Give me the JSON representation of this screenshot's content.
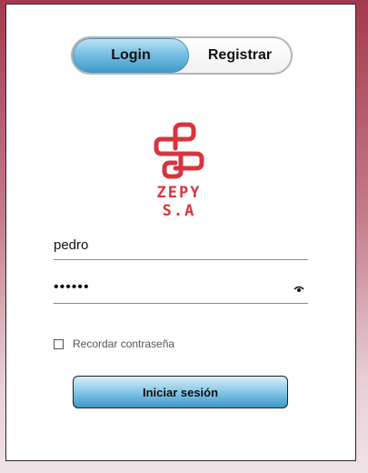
{
  "tabs": {
    "login_label": "Login",
    "register_label": "Registrar",
    "active": "Login"
  },
  "brand": {
    "name": "ZEPY S.A",
    "color": "#d8343f"
  },
  "form": {
    "username_value": "pedro",
    "password_masked": "••••••",
    "eye_icon": "eye-icon",
    "remember_label": "Recordar contraseña",
    "remember_checked": false,
    "submit_label": "Iniciar sesión"
  },
  "colors": {
    "accent": "#4aa3d3",
    "background_top": "#a43a4e",
    "background_bottom": "#efe3e6"
  }
}
